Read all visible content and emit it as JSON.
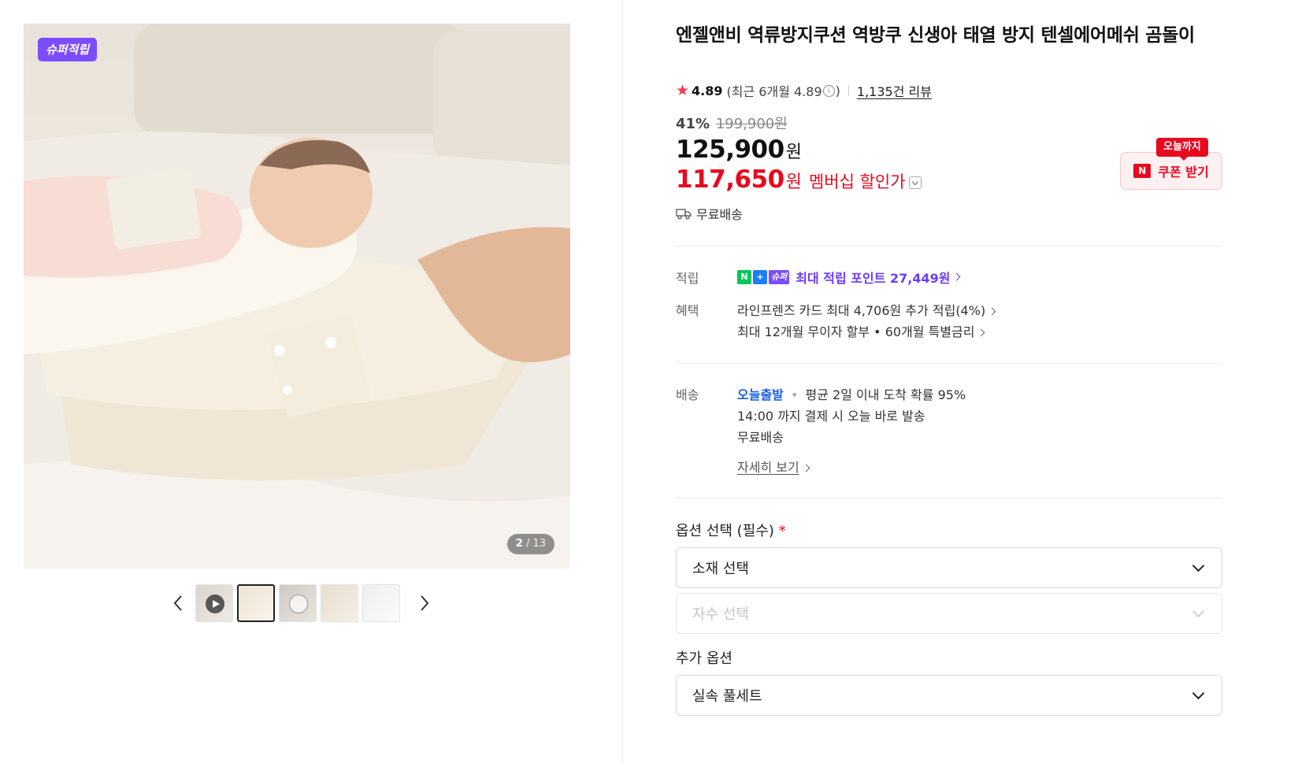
{
  "gallery": {
    "badge": "슈퍼적립",
    "counter_current": "2",
    "counter_total": "/ 13",
    "thumbnails": [
      "video",
      "image",
      "360",
      "image",
      "image"
    ],
    "active_index": 1
  },
  "product": {
    "title": "엔젤앤비 역류방지쿠션 역방쿠 신생아 태열 방지 텐셀에어메쉬 곰돌이",
    "rating": "4.89",
    "rating_recent": "(최근 6개월 4.89",
    "rating_recent_close": ")",
    "review_count": "1,135건 리뷰",
    "discount_rate": "41%",
    "original_price": "199,900원",
    "price": "125,900",
    "price_unit": "원",
    "member_price": "117,650",
    "member_unit": "원",
    "member_label": "멤버십 할인가",
    "shipping": "무료배송"
  },
  "coupon": {
    "tag": "오늘까지",
    "logo": "N",
    "label": "쿠폰 받기"
  },
  "points": {
    "label": "적립",
    "badges": [
      "N",
      "+",
      "슈퍼"
    ],
    "text": "최대 적립 포인트 27,449원"
  },
  "benefit": {
    "label": "혜택",
    "line1": "라인프렌즈 카드 최대 4,706원 추가 적립(4%)",
    "line2": "최대 12개월 무이자 할부 • 60개월 특별금리"
  },
  "delivery": {
    "label": "배송",
    "today": "오늘출발",
    "dot": "•",
    "avg": "평균 2일 이내 도착 확률 95%",
    "cutoff": "14:00 까지 결제 시 오늘 바로 발송",
    "fee": "무료배송",
    "detail_link": "자세히 보기"
  },
  "options": {
    "title": "옵션 선택 (필수)",
    "required_mark": "*",
    "select1": "소재 선택",
    "select2": "자수 선택",
    "extra_title": "추가 옵션",
    "select3": "실속 풀세트"
  },
  "colors": {
    "accent_red": "#e8091e",
    "super_purple": "#7b4dff",
    "points_purple": "#6a3cff",
    "today_blue": "#1a5ee8",
    "naver_green": "#03c75a"
  }
}
